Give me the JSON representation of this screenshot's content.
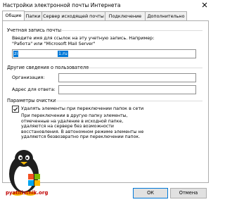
{
  "window": {
    "title": "Настройки электронной почты Интернета"
  },
  "tabs": [
    "Общие",
    "Папки",
    "Сервер исходящей почты",
    "Подключение",
    "Дополнительно"
  ],
  "account_group": {
    "title": "Учетная запись почты",
    "hint_line1": "Введите имя для ссылок на эту учетную запись. Например:",
    "hint_line2": "\"Работа\" или \"Microsoft Mail Server\"",
    "value_part1": "zi",
    "value_part2": "1.ru"
  },
  "user_group": {
    "title": "Другие сведения о пользователе",
    "org_label": "Организация:",
    "org_value": "",
    "reply_label": "Адрес для ответа:",
    "reply_value": ""
  },
  "cleanup_group": {
    "title": "Параметры очистки",
    "checkbox_label": "Удалять элементы при переключении папок в сети",
    "checkbox_checked": true,
    "description_lines": [
      "При переключении в другую папку элементы,",
      "отмеченные на удаление в исходной папке,",
      "удаляются на сервере без возможности",
      "восстановления. В автономном режиме элементы не",
      "удаляются безвозвратно при переключении папок."
    ]
  },
  "buttons": {
    "ok": "ОК",
    "cancel": "Отмена"
  },
  "watermark": {
    "text": "pyatilistnik.org"
  },
  "colors": {
    "selection": "#0078d7",
    "border": "#adadad",
    "button_face": "#e1e1e1"
  }
}
